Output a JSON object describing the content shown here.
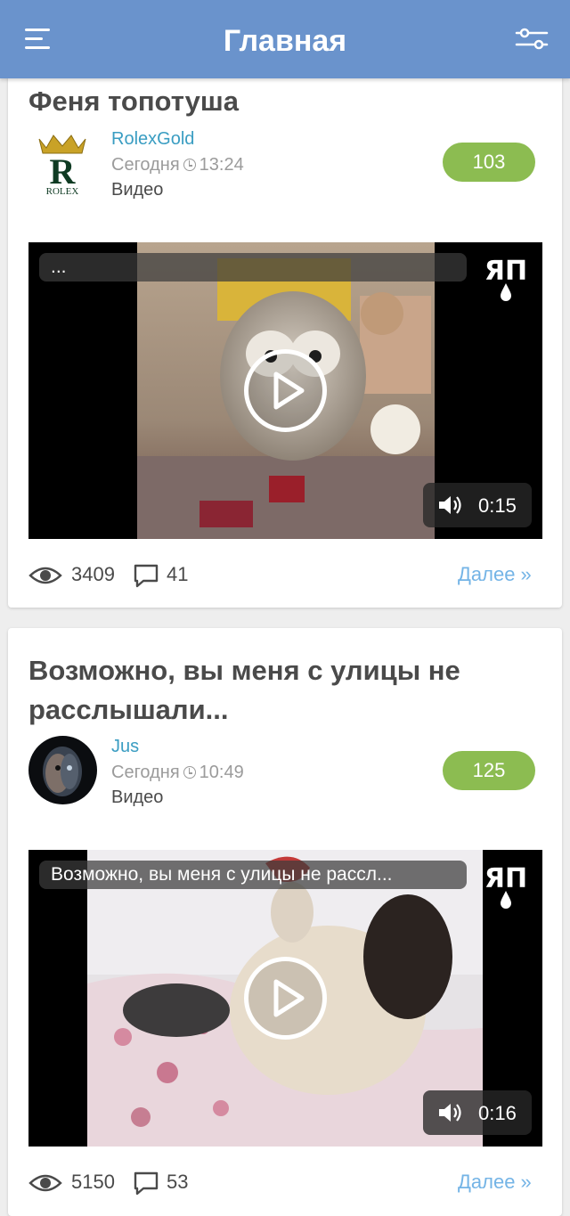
{
  "header": {
    "title": "Главная",
    "menu_icon": "hamburger-icon",
    "filter_icon": "filter-sliders-icon",
    "color": "#6a93cc"
  },
  "posts": [
    {
      "title": "Феня топотуша",
      "author": "RolexGold",
      "date": "Сегодня",
      "time": "13:24",
      "type": "Видео",
      "rating": "103",
      "video_caption": "...",
      "video_duration": "0:15",
      "views": "3409",
      "comments": "41",
      "more_label": "Далее »",
      "avatar_letter": "R",
      "avatar_text": "ROLEX"
    },
    {
      "title": "Возможно, вы меня с улицы не расслышали...",
      "author": "Jus",
      "date": "Сегодня",
      "time": "10:49",
      "type": "Видео",
      "rating": "125",
      "video_caption": "Возможно, вы меня с улицы не рассл...",
      "video_duration": "0:16",
      "views": "5150",
      "comments": "53",
      "more_label": "Далее »"
    }
  ],
  "colors": {
    "rating_green": "#8cbc51",
    "author_blue": "#3a9dc2",
    "link_blue": "#74b4e6"
  }
}
